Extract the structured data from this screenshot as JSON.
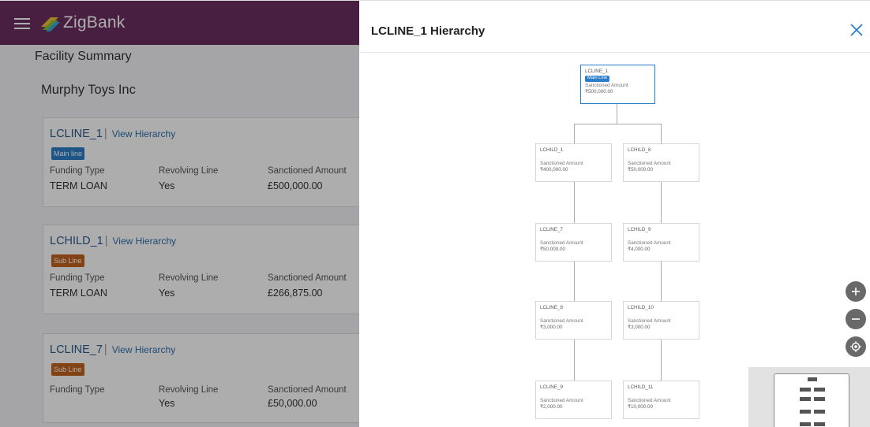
{
  "app": {
    "brand": "ZigBank",
    "page_title": "Facility Summary",
    "customer_name": "Murphy Toys Inc",
    "view_hierarchy_label": "View Hierarchy",
    "field_labels": {
      "funding_type": "Funding Type",
      "revolving_line": "Revolving Line",
      "sanctioned_amount": "Sanctioned Amount"
    },
    "cards": [
      {
        "name": "LCLINE_1",
        "badge": "Main line",
        "badge_type": "main",
        "funding_type": "TERM LOAN",
        "revolving": "Yes",
        "amount": "£500,000.00"
      },
      {
        "name": "LCHILD_1",
        "badge": "Sub Line",
        "badge_type": "sub",
        "funding_type": "TERM LOAN",
        "revolving": "Yes",
        "amount": "£266,875.00"
      },
      {
        "name": "LCLINE_7",
        "badge": "Sub Line",
        "badge_type": "sub",
        "funding_type": "",
        "revolving": "Yes",
        "amount": "£50,000.00"
      }
    ],
    "colors": {
      "header": "#6a2f60",
      "main_badge": "#2c7ec8",
      "sub_badge": "#c0621c",
      "link": "#2b5b8c"
    }
  },
  "panel": {
    "title": "LCLINE_1 Hierarchy",
    "close_icon": "close-icon",
    "node_amount_label": "Sanctioned Amount",
    "root": {
      "name": "LCLINE_1",
      "badge": "Main Line",
      "amount": "₹500,000.00"
    },
    "nodes": [
      {
        "name": "LCHILD_1",
        "amount": "₹400,000.00"
      },
      {
        "name": "LCHILD_8",
        "amount": "₹50,000.00"
      },
      {
        "name": "LCLINE_7",
        "amount": "₹50,000.00"
      },
      {
        "name": "LCHILD_9",
        "amount": "₹4,000.00"
      },
      {
        "name": "LCLINE_8",
        "amount": "₹3,000.00"
      },
      {
        "name": "LCHILD_10",
        "amount": "₹3,000.00"
      },
      {
        "name": "LCLINE_9",
        "amount": "₹2,000.00"
      },
      {
        "name": "LCHILD_11",
        "amount": "₹10,000.00"
      }
    ],
    "controls": [
      "zoom-in-icon",
      "zoom-out-icon",
      "recenter-icon"
    ]
  }
}
